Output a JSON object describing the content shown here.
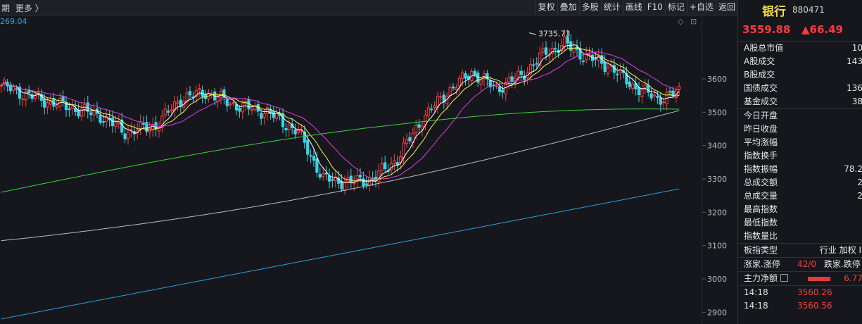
{
  "topbar": {
    "left_items": [
      "期",
      "更多 〉"
    ],
    "buttons": [
      "复权",
      "叠加",
      "多股",
      "统计",
      "画线",
      "F10",
      "标记",
      "+自选",
      "返回"
    ]
  },
  "ma_label": "269.04",
  "chart_icons": [
    "◇",
    "⊡"
  ],
  "chart_data": {
    "type": "candlestick",
    "peak_label": "3735.73",
    "y_ticks": [
      3600,
      3500,
      3400,
      3300,
      3200,
      3100,
      3000,
      2900
    ],
    "ylim": [
      2865,
      3790
    ],
    "colors": {
      "up": "#ff3d3d",
      "down": "#35d6e6",
      "ma5": "#ffffff",
      "ma10": "#f3f35a",
      "ma20": "#e040e0",
      "ma60": "#3fd13f",
      "ma120": "#bbbbbb",
      "ma250": "#2e9bd8"
    }
  },
  "quote": {
    "name": "银行",
    "code": "880471",
    "last": "3559.88",
    "change": "▲66.49"
  },
  "stats": [
    {
      "label": "A股总市值",
      "value": "10"
    },
    {
      "label": "A股成交",
      "value": "143"
    },
    {
      "label": "B股成交",
      "value": ""
    },
    {
      "label": "国债成交",
      "value": "136"
    },
    {
      "label": "基金成交",
      "value": "38"
    },
    {
      "label": "今日开盘",
      "value": ""
    },
    {
      "label": "昨日收盘",
      "value": ""
    },
    {
      "label": "平均涨幅",
      "value": ""
    },
    {
      "label": "指数换手",
      "value": ""
    },
    {
      "label": "指数振幅",
      "value": "78.2"
    },
    {
      "label": "总成交额",
      "value": "2"
    },
    {
      "label": "总成交量",
      "value": "2"
    },
    {
      "label": "最高指数",
      "value": ""
    },
    {
      "label": "最低指数",
      "value": ""
    },
    {
      "label": "指数量比",
      "value": ""
    }
  ],
  "board": {
    "label": "板指类型",
    "value": "行业 加权 I"
  },
  "rise": {
    "label": "涨家.涨停",
    "value": "42/0",
    "label2": "跌家.跌停"
  },
  "fund": {
    "label": "主力净额",
    "value": "6.77"
  },
  "ticks": [
    {
      "time": "14:18",
      "price": "3560.26"
    },
    {
      "time": "14:18",
      "price": "3560.56"
    }
  ]
}
